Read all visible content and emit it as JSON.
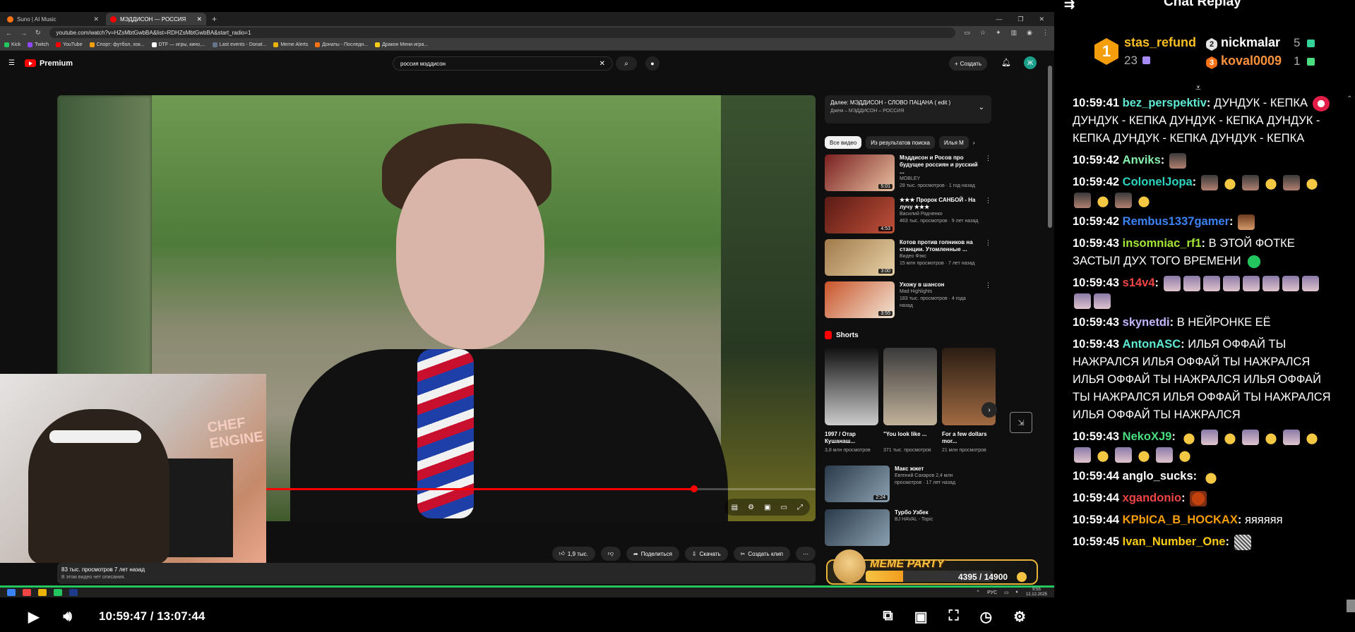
{
  "browser": {
    "tabs": [
      {
        "title": "Suno | AI Music",
        "color": "#f97316"
      },
      {
        "title": "МЭДДИСОН — РОССИЯ",
        "color": "#ff0000"
      }
    ],
    "url": "youtube.com/watch?v=HZsMbtGwbBA&list=RDHZsMbtGwbBA&start_radio=1",
    "bookmarks": [
      {
        "label": "Kick",
        "color": "#22c55e"
      },
      {
        "label": "Twitch",
        "color": "#9146ff"
      },
      {
        "label": "YouTube",
        "color": "#ff0000"
      },
      {
        "label": "Спорт: футбол, хок...",
        "color": "#f59e0b"
      },
      {
        "label": "DTF — игры, кино,...",
        "color": "#ffffff"
      },
      {
        "label": "Last events - Donat...",
        "color": "#64748b"
      },
      {
        "label": "Meme Alerts",
        "color": "#eab308"
      },
      {
        "label": "Донаты - Последн...",
        "color": "#f97316"
      },
      {
        "label": "Дракон Мени игра...",
        "color": "#facc15"
      }
    ]
  },
  "youtube": {
    "brand": "Premium",
    "search_value": "россия мэддисон",
    "create_label": "Создать",
    "avatar_letter": "Ж",
    "video_progress_fraction": 0.84,
    "actions": [
      "1,9 тыс.",
      "Поделиться",
      "Скачать",
      "Создать клип"
    ],
    "views_line": "83 тыс. просмотров  7 лет назад",
    "desc_line": "В этом видео нет описания.",
    "next_title": "Далее: МЭДДИСОН - СЛОВО ПАЦАНА ( edit )",
    "next_sub": "Джем – МЭДДИСОН – РОССИЯ",
    "chips": [
      "Все видео",
      "Из результатов поиска",
      "Илья М"
    ],
    "recs": [
      {
        "title": "Мэддисон и Росов про будущее россиян и русский ...",
        "channel": "MOBLEY",
        "meta": "28 тыс. просмотров · 1 год назад",
        "dur": "5:01",
        "c1": "#7a1f1f",
        "c2": "#e7c0a0"
      },
      {
        "title": "★★★ Пророк САНБОЙ - На лучу ★★★",
        "channel": "Василий Радченко",
        "meta": "463 тыс. просмотров · 9 лет назад",
        "dur": "4:53",
        "c1": "#5a1a14",
        "c2": "#c0503a"
      },
      {
        "title": "Котов против гопников на станции. Утомленные ...",
        "channel": "Видео Фэкс",
        "meta": "15 млн просмотров · 7 лет назад",
        "dur": "3:00",
        "c1": "#a07a4a",
        "c2": "#e8d2a8"
      },
      {
        "title": "Ухожу в шансон",
        "channel": "Mad Highlights",
        "meta": "183 тыс. просмотров · 4 года назад",
        "dur": "3:55",
        "c1": "#c9542a",
        "c2": "#f1e6d6"
      }
    ],
    "shorts_title": "Shorts",
    "shorts": [
      {
        "title": "1997 / Отар Кушанаш...",
        "meta": "3,8 млн просмотров",
        "c1": "#111",
        "c2": "#ccc"
      },
      {
        "title": "\"You look like ...",
        "meta": "371 тыс. просмотров",
        "c1": "#3a3a3a",
        "c2": "#c2b29a"
      },
      {
        "title": "For a few dollars mor...",
        "meta": "21 млн просмотров",
        "c1": "#2a1d14",
        "c2": "#a06a42"
      }
    ],
    "more_recs": [
      {
        "title": "Макс жжет",
        "meta": "Евгений Сахаров  2,4 млн просмотров · 17 лет назад",
        "dur": "2:24"
      },
      {
        "title": "Турбо Узбек",
        "meta": "BJ HAVAL - Topic",
        "dur": ""
      }
    ]
  },
  "alert": {
    "title": "MEME PARTY",
    "value": "4395 / 14900",
    "fraction": 0.295
  },
  "webcam_sign": "CHEF ENGINE",
  "taskbar": {
    "lang": "РУС",
    "time": "9:55",
    "date": "12.12.2025"
  },
  "player": {
    "time": "10:59:47 / 13:07:44"
  },
  "chat": {
    "title": "Chat Replay",
    "leaders": [
      {
        "rank": "1",
        "name": "stas_refund",
        "count": "23",
        "gift": "#a78bfa"
      },
      {
        "rank": "2",
        "name": "nickmalar",
        "count": "5",
        "gift": "#34d399"
      },
      {
        "rank": "3",
        "name": "koval0009",
        "count": "1",
        "gift": "#4ade80"
      }
    ],
    "messages": [
      {
        "ts": "10:59:41",
        "user": "bez_perspektiv",
        "color": "#5eead4",
        "text": "ДУНДУК - КЕПКА",
        "emotes": [
          "heart"
        ],
        "tail": "ДУНДУК - КЕПКА  ДУНДУК - КЕПКА  ДУНДУК - КЕПКА  ДУНДУК - КЕПКА  ДУНДУК - КЕПКА"
      },
      {
        "ts": "10:59:42",
        "user": "Anviks",
        "color": "#86efac",
        "text": "",
        "emotes": [
          "face"
        ],
        "tail": ""
      },
      {
        "ts": "10:59:42",
        "user": "ColonelJopa",
        "color": "#2dd4bf",
        "text": "",
        "emotes": [
          "face",
          "duck",
          "face",
          "duck",
          "face",
          "duck",
          "face",
          "duck",
          "face",
          "duck"
        ],
        "tail": ""
      },
      {
        "ts": "10:59:42",
        "user": "Rembus1337gamer",
        "color": "#3b82f6",
        "text": "",
        "emotes": [
          "man"
        ],
        "tail": ""
      },
      {
        "ts": "10:59:43",
        "user": "insomniac_rf1",
        "color": "#a3e635",
        "text": "В ЭТОЙ ФОТКЕ ЗАСТЫЛ ДУХ ТОГО ВРЕМЕНИ",
        "emotes": [
          "green"
        ],
        "tail": ""
      },
      {
        "ts": "10:59:43",
        "user": "s14v4",
        "color": "#ef4444",
        "text": "",
        "emotes": [
          "pale",
          "pale",
          "pale",
          "pale",
          "pale",
          "pale",
          "pale",
          "pale",
          "pale",
          "pale"
        ],
        "tail": ""
      },
      {
        "ts": "10:59:43",
        "user": "skynetdi",
        "color": "#c4b5fd",
        "text": "В НЕЙРОНКЕ ЕЁ",
        "emotes": [],
        "tail": ""
      },
      {
        "ts": "10:59:43",
        "user": "AntonASC",
        "color": "#5eead4",
        "text": "ИЛЬЯ ОФФАЙ ТЫ НАЖРАЛСЯ ИЛЬЯ ОФФАЙ ТЫ НАЖРАЛСЯ ИЛЬЯ ОФФАЙ ТЫ НАЖРАЛСЯ ИЛЬЯ ОФФАЙ ТЫ НАЖРАЛСЯ ИЛЬЯ ОФФАЙ ТЫ НАЖРАЛСЯ ИЛЬЯ ОФФАЙ ТЫ НАЖРАЛСЯ",
        "emotes": [],
        "tail": ""
      },
      {
        "ts": "10:59:43",
        "user": "NekoXJ9",
        "color": "#4ade80",
        "text": "",
        "emotes": [
          "duck",
          "pale",
          "duck",
          "pale",
          "duck",
          "pale",
          "duck",
          "pale",
          "duck",
          "pale",
          "duck",
          "pale",
          "duck"
        ],
        "tail": ""
      },
      {
        "ts": "10:59:44",
        "user": "anglo_sucks",
        "color": "#ffffff",
        "text": "",
        "emotes": [
          "duck"
        ],
        "tail": ""
      },
      {
        "ts": "10:59:44",
        "user": "xgandonio",
        "color": "#ef4444",
        "text": "",
        "emotes": [
          "red"
        ],
        "tail": ""
      },
      {
        "ts": "10:59:44",
        "user": "KPbICA_B_HOCKAX",
        "color": "#f59e0b",
        "text": "яяяяяя",
        "emotes": [],
        "tail": ""
      },
      {
        "ts": "10:59:45",
        "user": "Ivan_Number_One",
        "color": "#facc15",
        "text": "",
        "emotes": [
          "sketch"
        ],
        "tail": ""
      }
    ]
  }
}
